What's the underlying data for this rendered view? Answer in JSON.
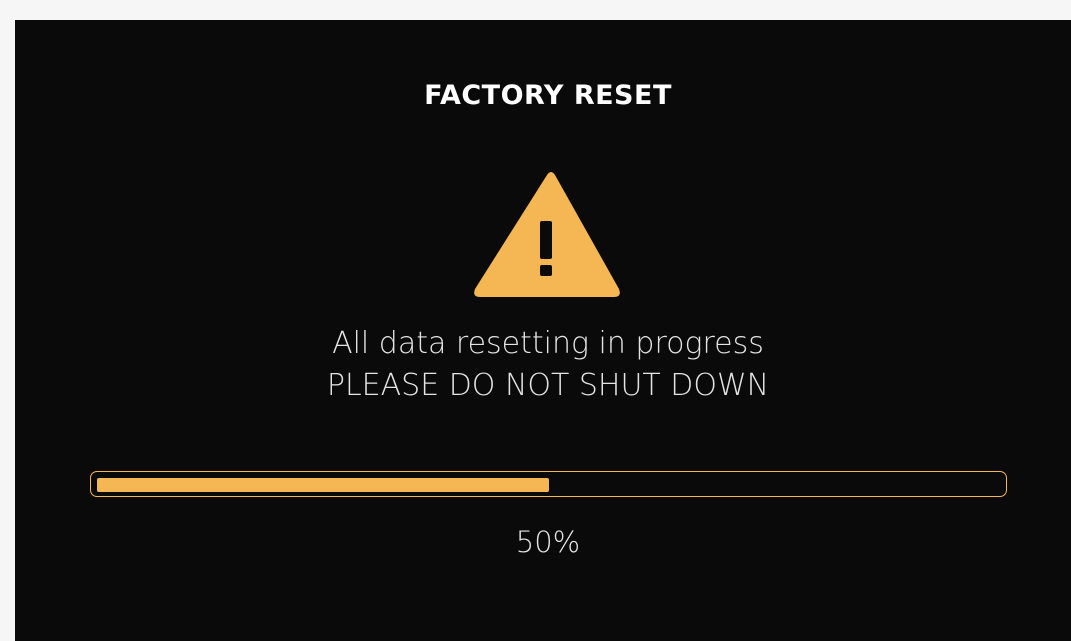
{
  "dialog": {
    "title": "FACTORY RESET",
    "message_line1": "All data resetting in progress",
    "message_line2": "PLEASE DO NOT SHUT DOWN",
    "warning_icon": "warning-triangle-icon"
  },
  "progress": {
    "value": 0.5,
    "label": "50%"
  },
  "colors": {
    "background": "#0a0a0a",
    "accent": "#f4b754",
    "text": "#e4e4e4",
    "title": "#ffffff"
  }
}
